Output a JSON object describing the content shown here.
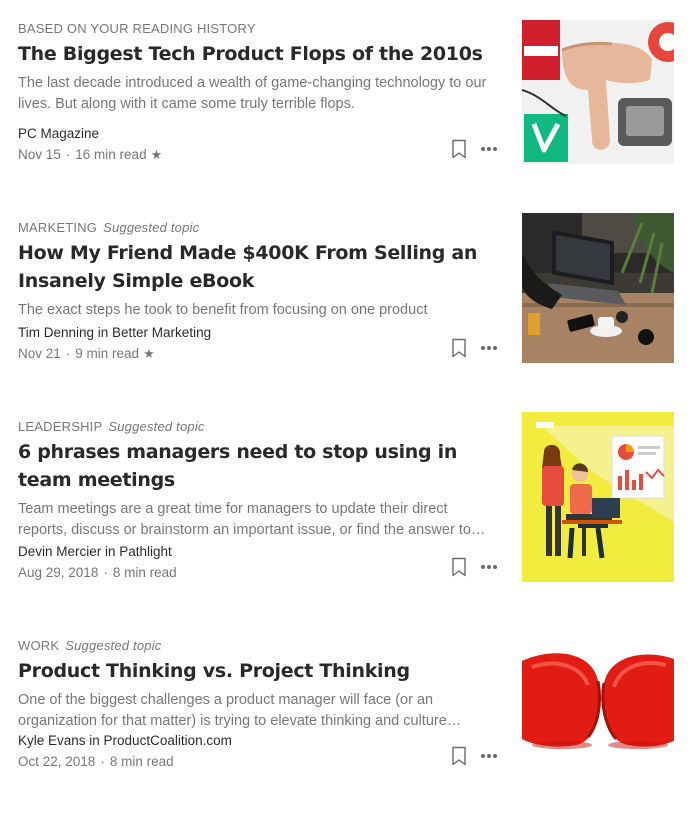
{
  "articles": [
    {
      "topic": "BASED ON YOUR READING HISTORY",
      "suggested": "",
      "title": "The Biggest Tech Product Flops of the 2010s",
      "subtitle": "The last decade introduced a wealth of game-changing technology to our lives. But along with it came some truly terrible flops.",
      "author": "PC Magazine",
      "date": "Nov 15",
      "read_time": "16 min read",
      "star": "★",
      "thumbnail": "thumbs-down-gadgets-image"
    },
    {
      "topic": "MARKETING",
      "suggested": "Suggested topic",
      "title": "How My Friend Made $400K From Selling an Insanely Simple eBook",
      "subtitle": "The exact steps he took to benefit from focusing on one product",
      "author": "Tim Denning in Better Marketing",
      "date": "Nov 21",
      "read_time": "9 min read",
      "star": "★",
      "thumbnail": "laptop-cafe-image"
    },
    {
      "topic": "LEADERSHIP",
      "suggested": "Suggested topic",
      "title": "6 phrases managers need to stop using in team meetings",
      "subtitle": "Team meetings are a great time for managers to update their direct reports, discuss or brainstorm an important issue, or find the answer to…",
      "author": "Devin Mercier in Pathlight",
      "date": "Aug 29, 2018",
      "read_time": "8 min read",
      "star": "",
      "thumbnail": "team-meeting-illustration"
    },
    {
      "topic": "WORK",
      "suggested": "Suggested topic",
      "title": "Product Thinking vs. Project Thinking",
      "subtitle": "One of the biggest challenges a product manager will face (or an organization for that matter) is trying to elevate thinking and culture…",
      "author": "Kyle Evans in ProductCoalition.com",
      "date": "Oct 22, 2018",
      "read_time": "8 min read",
      "star": "",
      "thumbnail": "boxing-gloves-image"
    }
  ],
  "icons": {
    "bookmark": "bookmark-icon",
    "more": "more-icon"
  },
  "colors": {
    "text_primary": "#292929",
    "text_secondary": "#757575",
    "yellow_bg": "#f2ec3f",
    "glove_red": "#e21b14"
  }
}
